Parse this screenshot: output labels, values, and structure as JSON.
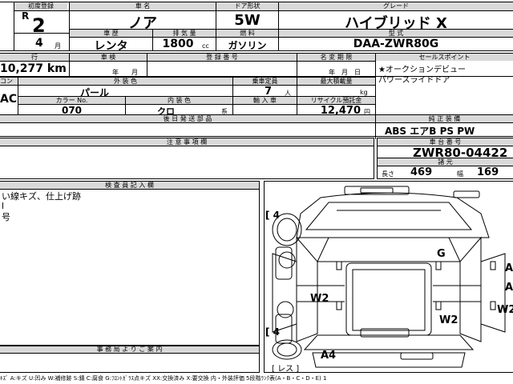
{
  "header": {
    "first_reg_label": "初度登録",
    "era": "R",
    "year": "2",
    "month": "4",
    "month_unit": "月",
    "car_name_label": "車 名",
    "car_name": "ノア",
    "door_label": "ドア形状",
    "door": "5W",
    "grade_label": "グレード",
    "grade": "ハイブリッド X",
    "type_label": "車 歴",
    "type": "レンタ",
    "displacement_label": "排 気 量",
    "displacement": "1800",
    "displacement_unit": "cc",
    "fuel_label": "燃 料",
    "fuel": "ガソリン",
    "model_label": "型 式",
    "model": "DAA-ZWR80G"
  },
  "row2": {
    "mileage_label": "行",
    "mileage": "10,277 km",
    "inspection_label": "車 検",
    "inspection_units": "年　　月",
    "reg_no_label": "登 録 番 号",
    "expiry_label": "名 変 期 限",
    "expiry_units": "年　月　日",
    "sale_point_label": "セールスポイント",
    "sale_point_1": "★オークションデビュー",
    "sale_point_2": "パワースライドドア"
  },
  "row3": {
    "left_label": "コン",
    "exterior_label": "外 装 色",
    "exterior": "パール",
    "capacity_label": "乗車定員",
    "capacity": "7",
    "capacity_unit": "人",
    "load_label": "最大積載量",
    "load_unit": "kg",
    "ac": "AC",
    "color_no_label": "カラー No.",
    "color_no": "070",
    "interior_label": "内 装 色",
    "interior": "クロ",
    "interior_unit": "系",
    "import_label": "輸 入 車",
    "recycle_label": "リサイクル預託金",
    "recycle": "12,470",
    "recycle_unit": "円"
  },
  "row4": {
    "rear_seat_label": "後 日 発 送 部 品",
    "equipment_label": "純 正 装 備",
    "equipment": "ABS エアB PS PW",
    "notes_label": "注 意 事 項 欄",
    "chassis_label": "車 台 番 号",
    "chassis": "ZWR80-04422",
    "dims_label": "諸 元",
    "length_label": "長さ",
    "length": "469",
    "width_label": "幅",
    "width": "169"
  },
  "inspector": {
    "label": "検 査 員 記 入 欄",
    "line1": "い線キズ、仕上げ跡",
    "line2": "l",
    "line3": "号"
  },
  "office": {
    "label": "事 務 局 よ り ご 案 内"
  },
  "diagram": {
    "tire_fl": "[ 4",
    "tire_rl": "[ 4",
    "spare": "[ レス ]",
    "marks": [
      "G",
      "W2",
      "W2",
      "A4",
      "A",
      "A",
      "W2"
    ]
  },
  "legend": "ｷｽﾞ A:キズ U:凹み W:補修跡 S:錆 C:腐食 G:ﾌﾛﾝﾄｶﾞﾗｽ点キズ XX:交換済み X:要交換 内・外装評価 5段階ﾗﾝｸ表(A・B・C・D・E) 1"
}
